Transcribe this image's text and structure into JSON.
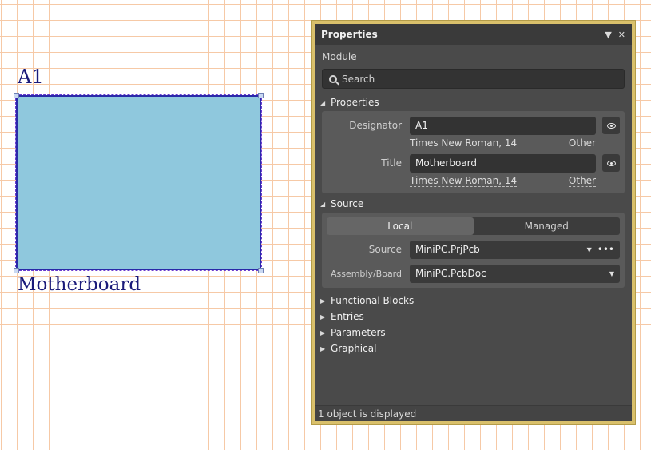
{
  "canvas": {
    "designator_text": "A1",
    "title_text": "Motherboard",
    "colors": {
      "sheet_fill": "#8fc8dd",
      "sheet_border": "#2a2aa8",
      "grid": "#f6c9a6",
      "text": "#1a1a7a"
    }
  },
  "panel": {
    "title": "Properties",
    "object_type": "Module",
    "search_placeholder": "Search",
    "properties_section": {
      "label": "Properties",
      "designator": {
        "label": "Designator",
        "value": "A1",
        "font": "Times New Roman, 14",
        "other": "Other"
      },
      "title": {
        "label": "Title",
        "value": "Motherboard",
        "font": "Times New Roman, 14",
        "other": "Other"
      }
    },
    "source_section": {
      "label": "Source",
      "tabs": {
        "local": "Local",
        "managed": "Managed",
        "active": "Local"
      },
      "source": {
        "label": "Source",
        "value": "MiniPC.PrjPcb"
      },
      "assembly": {
        "label": "Assembly/Board",
        "value": "MiniPC.PcbDoc"
      }
    },
    "collapsed_sections": [
      "Functional Blocks",
      "Entries",
      "Parameters",
      "Graphical"
    ],
    "status": "1 object is displayed",
    "colors": {
      "frame": "#d9c06b",
      "panel_bg": "#4a4a4a",
      "header_bg": "#3a3a3a"
    }
  }
}
